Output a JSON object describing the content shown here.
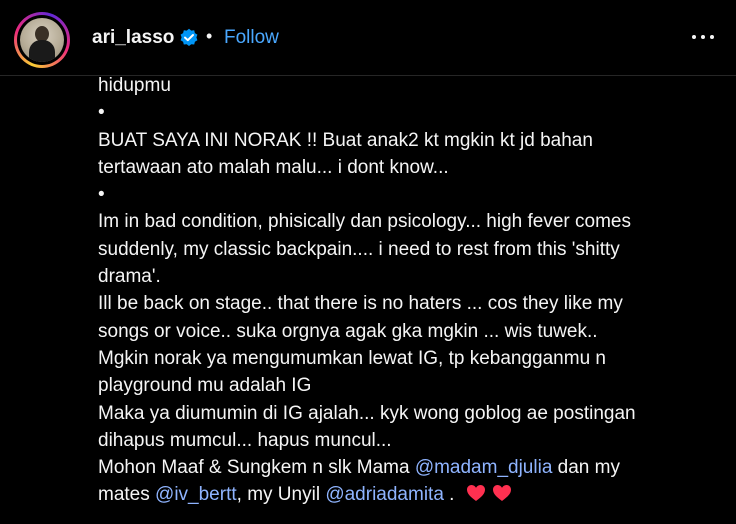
{
  "header": {
    "username": "ari_lasso",
    "separator": "•",
    "follow_label": "Follow",
    "more_icon": "more-horizontal-icon",
    "verified_icon": "verified-badge-icon"
  },
  "caption": {
    "l0": "hidupmu",
    "b1": "•",
    "l1": "BUAT SAYA INI NORAK !! Buat anak2 kt mgkin kt jd bahan",
    "l2": "tertawaan ato malah malu... i dont know...",
    "b2": "•",
    "l3": "Im in bad condition, phisically dan psicology... high fever comes",
    "l4": "suddenly, my classic backpain.... i need to rest from this 'shitty",
    "l5": "drama'.",
    "l6": "Ill be back on stage.. that there is no haters ... cos they like my",
    "l7": "songs or voice.. suka orgnya agak gka mgkin ... wis tuwek..",
    "l8": "Mgkin norak ya mengumumkan lewat IG, tp kebangganmu n",
    "l9": "playground mu adalah IG",
    "l10": "Maka ya diumumin di IG ajalah... kyk wong goblog ae postingan",
    "l11": "dihapus mumcul... hapus muncul...",
    "l12a": "Mohon Maaf & Sungkem n slk Mama ",
    "m1": "@madam_djulia",
    "l12b": " dan my",
    "l13a": "mates ",
    "m2": "@iv_bertt",
    "l13b": ", my Unyil ",
    "m3": "@adriadamita",
    "l13c": " . "
  },
  "colors": {
    "background": "#000000",
    "follow": "#4aa8ff",
    "mention": "#8fb4ff",
    "verified": "#0095f6",
    "heart": "#ff3050"
  }
}
